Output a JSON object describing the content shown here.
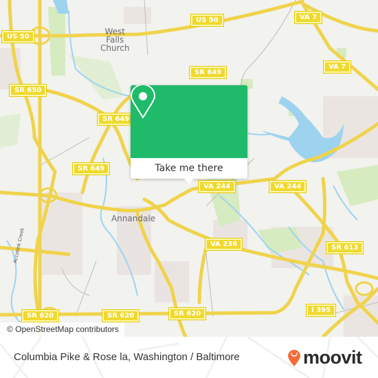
{
  "map": {
    "place_labels": [
      {
        "id": "west-falls-church",
        "lines": [
          "West",
          "Falls",
          "Church"
        ]
      },
      {
        "id": "annandale",
        "lines": [
          "Annandale"
        ]
      }
    ],
    "water_labels": [
      {
        "id": "accotink-creek",
        "text": "Accotink Creek"
      }
    ],
    "road_shields": [
      {
        "id": "us-50-west",
        "text": "US 50"
      },
      {
        "id": "us-50-east",
        "text": "US 50"
      },
      {
        "id": "va-7-north",
        "text": "VA 7"
      },
      {
        "id": "va-7-south",
        "text": "VA 7"
      },
      {
        "id": "sr-650",
        "text": "SR 650"
      },
      {
        "id": "sr-649-north",
        "text": "SR 649"
      },
      {
        "id": "sr-649-mid",
        "text": "SR 649"
      },
      {
        "id": "sr-649-west",
        "text": "SR 649"
      },
      {
        "id": "va-244-west",
        "text": "VA 244"
      },
      {
        "id": "va-244-east",
        "text": "VA 244"
      },
      {
        "id": "va-236",
        "text": "VA 236"
      },
      {
        "id": "sr-613",
        "text": "SR 613"
      },
      {
        "id": "sr-620-west",
        "text": "SR 620"
      },
      {
        "id": "sr-620-mid",
        "text": "SR 620"
      },
      {
        "id": "sr-620-east",
        "text": "SR 620"
      },
      {
        "id": "i-395",
        "text": "I 395"
      }
    ],
    "attribution": "© OpenStreetMap contributors",
    "colors": {
      "land": "#f2f2ef",
      "road": "#f7df5e",
      "water": "#9ed3ef",
      "park": "#d6ebc0",
      "urban": "#e9e2e0"
    }
  },
  "popup": {
    "icon": "map-pin-icon",
    "button_label": "Take me there",
    "color": "#1fba6a"
  },
  "footer": {
    "title": "Columbia Pike & Rose la, Washington / Baltimore",
    "brand": "moovit",
    "brand_color": "#f26b38"
  }
}
